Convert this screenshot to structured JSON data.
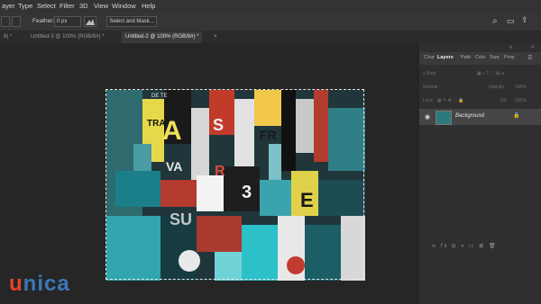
{
  "menu": [
    "ayer",
    "Type",
    "Select",
    "Filter",
    "3D",
    "View",
    "Window",
    "Help"
  ],
  "options": {
    "feather_label": "Feather:",
    "feather_value": "0 px",
    "select_mask": "Select and Mask..."
  },
  "tabs": [
    {
      "label": "8) *"
    },
    {
      "label": "Untitled-3 @ 100% (RGB/8#) *"
    },
    {
      "label": "Untitled-2 @ 100% (RGB/8#) *"
    }
  ],
  "panel": {
    "tabs": [
      "Char",
      "Layers",
      "Path",
      "Colo",
      "Swa",
      "Prop"
    ],
    "kind_label": "Kind",
    "blend_mode": "Normal",
    "opacity_label": "Opacity:",
    "opacity_value": "100%",
    "lock_label": "Lock:",
    "fill_label": "Fill:",
    "fill_value": "100%",
    "layer_name": "Background"
  },
  "collage_text": [
    "DE TE",
    "TRA",
    "A",
    "S",
    "FR",
    "VA",
    "3",
    "E",
    "R",
    "SU"
  ],
  "logo": {
    "text_u": "u",
    "text_rest": "nica",
    "color_u": "#e8432e",
    "color_rest": "#3a78b8"
  }
}
